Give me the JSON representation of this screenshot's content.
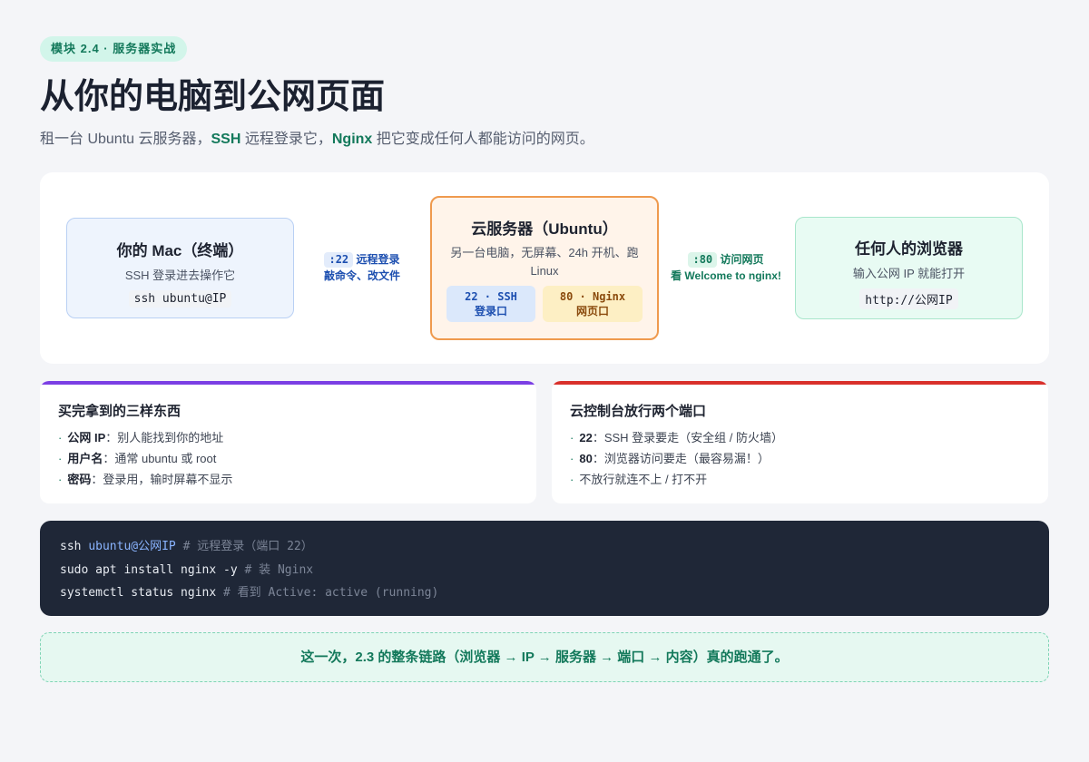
{
  "header": {
    "badge": "模块 2.4 · 服务器实战",
    "title": "从你的电脑到公网页面",
    "subtitle_parts": [
      "租一台 Ubuntu 云服务器，",
      "SSH",
      " 远程登录它，",
      "Nginx",
      " 把它变成任何人都能访问的网页。"
    ]
  },
  "diagram": {
    "mac": {
      "title": "你的 Mac（终端）",
      "desc": "SSH 登录进去操作它",
      "code": "ssh ubuntu@IP"
    },
    "link_left": {
      "port": ":22",
      "label": "远程登录",
      "desc": "敲命令、改文件"
    },
    "server": {
      "title": "云服务器（Ubuntu）",
      "desc": "另一台电脑，无屏幕、24h 开机、跑 Linux",
      "ports": [
        {
          "top": "22 · SSH",
          "bottom": "登录口"
        },
        {
          "top": "80 · Nginx",
          "bottom": "网页口"
        }
      ]
    },
    "link_right": {
      "port": ":80",
      "label": "访问网页",
      "desc": "看 Welcome to nginx!"
    },
    "browser": {
      "title": "任何人的浏览器",
      "desc": "输入公网 IP 就能打开",
      "code": "http://公网IP"
    }
  },
  "cards": [
    {
      "title": "买完拿到的三样东西",
      "accent": "#7b3fe4",
      "items": [
        {
          "key": "公网 IP",
          "text": "：别人能找到你的地址"
        },
        {
          "key": "用户名",
          "text": "：通常 ubuntu 或 root"
        },
        {
          "key": "密码",
          "text": "：登录用，输时屏幕不显示"
        }
      ]
    },
    {
      "title": "云控制台放行两个端口",
      "accent": "#d9302b",
      "items": [
        {
          "key": "22",
          "text": "：SSH 登录要走（安全组 / 防火墙）"
        },
        {
          "key": "80",
          "text": "：浏览器访问要走（最容易漏！）"
        },
        {
          "key": "",
          "text": "不放行就连不上 / 打不开"
        }
      ]
    }
  ],
  "terminal": [
    {
      "cmd": "ssh ",
      "arg": "ubuntu@公网IP",
      "comment": " # 远程登录（端口 22）"
    },
    {
      "cmd": "sudo apt install nginx -y",
      "arg": "",
      "comment": " # 装 Nginx"
    },
    {
      "cmd": "systemctl status nginx",
      "arg": "",
      "comment": " # 看到 Active: active (running)"
    }
  ],
  "footer": "这一次，2.3 的整条链路（浏览器 → IP → 服务器 → 端口 → 内容）真的跑通了。"
}
